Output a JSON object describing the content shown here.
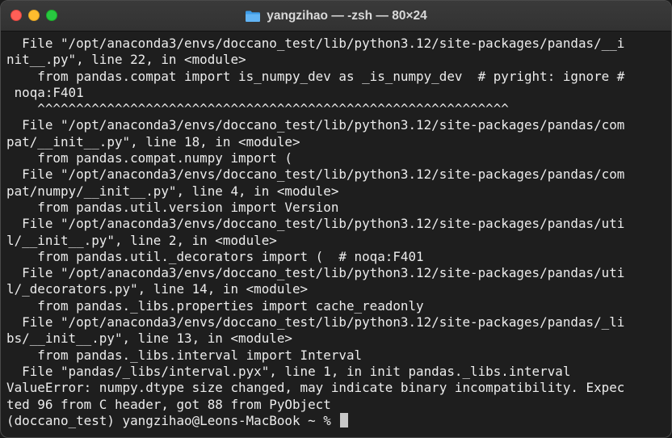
{
  "window": {
    "title": "yangzihao — -zsh — 80×24",
    "folder_icon": "folder-icon",
    "colors": {
      "close": "#ff5f57",
      "minimize": "#febc2e",
      "maximize": "#28c840",
      "background": "#1e1e1e",
      "text": "#ececec"
    }
  },
  "terminal": {
    "lines": [
      "  File \"/opt/anaconda3/envs/doccano_test/lib/python3.12/site-packages/pandas/__i",
      "nit__.py\", line 22, in <module>",
      "    from pandas.compat import is_numpy_dev as _is_numpy_dev  # pyright: ignore #",
      " noqa:F401",
      "    ^^^^^^^^^^^^^^^^^^^^^^^^^^^^^^^^^^^^^^^^^^^^^^^^^^^^^^^^^^^^^",
      "  File \"/opt/anaconda3/envs/doccano_test/lib/python3.12/site-packages/pandas/com",
      "pat/__init__.py\", line 18, in <module>",
      "    from pandas.compat.numpy import (",
      "  File \"/opt/anaconda3/envs/doccano_test/lib/python3.12/site-packages/pandas/com",
      "pat/numpy/__init__.py\", line 4, in <module>",
      "    from pandas.util.version import Version",
      "  File \"/opt/anaconda3/envs/doccano_test/lib/python3.12/site-packages/pandas/uti",
      "l/__init__.py\", line 2, in <module>",
      "    from pandas.util._decorators import (  # noqa:F401",
      "  File \"/opt/anaconda3/envs/doccano_test/lib/python3.12/site-packages/pandas/uti",
      "l/_decorators.py\", line 14, in <module>",
      "    from pandas._libs.properties import cache_readonly",
      "  File \"/opt/anaconda3/envs/doccano_test/lib/python3.12/site-packages/pandas/_li",
      "bs/__init__.py\", line 13, in <module>",
      "    from pandas._libs.interval import Interval",
      "  File \"pandas/_libs/interval.pyx\", line 1, in init pandas._libs.interval",
      "ValueError: numpy.dtype size changed, may indicate binary incompatibility. Expec",
      "ted 96 from C header, got 88 from PyObject"
    ],
    "prompt": "(doccano_test) yangzihao@Leons-MacBook ~ % "
  }
}
